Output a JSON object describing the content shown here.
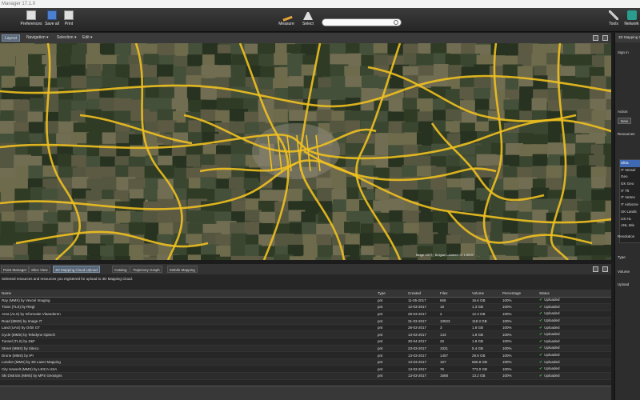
{
  "window": {
    "title": "Manager 17.1.0"
  },
  "ribbon": {
    "buttons": [
      {
        "label": "Preferences",
        "icon": "preferences-icon"
      },
      {
        "label": "Save all",
        "icon": "save-icon"
      },
      {
        "label": "Print",
        "icon": "print-icon"
      },
      {
        "label": "Measure",
        "icon": "measure-icon"
      },
      {
        "label": "Select",
        "icon": "select-icon"
      },
      {
        "label": "Tools",
        "icon": "tools-icon"
      },
      {
        "label": "Network",
        "icon": "network-icon"
      }
    ],
    "search_placeholder": ""
  },
  "map": {
    "tabs": [
      {
        "label": "Layout"
      },
      {
        "label": "Navigation ▾"
      },
      {
        "label": "Selection ▾"
      },
      {
        "label": "Edit ▾"
      }
    ],
    "status": "Belge 1977 · Belgian Lambert 72    1:5000",
    "colors": {
      "road": "#f0c020",
      "field_dark": "#2f3b25",
      "field_light": "#6e6a4c"
    }
  },
  "right_panel": {
    "title": "3D Mapping Cloud",
    "sign_in": "Sign in",
    "action": "Action",
    "new_button": "New",
    "resources": "Resources",
    "list": [
      "Ultra",
      "IT Vessel",
      "Geo",
      "GK Geo",
      "IT Tlt",
      "IT Vertex",
      "IT Airborne",
      "UK Lands",
      "US HL",
      "ANL Mis"
    ],
    "resolution_label": "Resolution",
    "type": "Type",
    "volume": "Volume",
    "upload": "Upload"
  },
  "bottom": {
    "tabs": [
      {
        "label": "Point Manager"
      },
      {
        "label": "Slice View"
      },
      {
        "label": "3D Mapping Cloud Upload"
      },
      {
        "label": "Catalog"
      },
      {
        "label": "Trajectory Graph"
      },
      {
        "label": "Mobile Mapping"
      }
    ],
    "info": "Selected resources and resources you registered for upload to 3D Mapping Cloud.",
    "columns": [
      "Name",
      "Type",
      "Created",
      "Files",
      "Volume",
      "Percentage",
      "Status"
    ],
    "rows": [
      [
        "Ray (MMS) by Vexcel Imaging",
        "pnt",
        "11-05-2017",
        "658",
        "16.6 GB",
        "100%",
        "Uploaded"
      ],
      [
        "Trans (TLS) by Riegl",
        "pnt",
        "12-03-2017",
        "18",
        "1.3 GB",
        "100%",
        "Uploaded"
      ],
      [
        "Area (ALS) by Informatie Vlaanderen",
        "pnt",
        "29-03-2017",
        "2",
        "12.3 GB",
        "100%",
        "Uploaded"
      ],
      [
        "Road (MMS) by Image IT",
        "pnt",
        "31-03-2017",
        "10523",
        "118.3 GB",
        "100%",
        "Uploaded"
      ],
      [
        "Land (UAS) by Orbit GT",
        "pnt",
        "28-03-2017",
        "3",
        "1.8 GB",
        "100%",
        "Uploaded"
      ],
      [
        "Cycle (MMS) by Teledyne Optech",
        "pnt",
        "13-03-2017",
        "143",
        "1.8 GB",
        "100%",
        "Uploaded"
      ],
      [
        "Tunnel (TLS) by Z&F",
        "pnt",
        "30-04-2017",
        "26",
        "1.8 GB",
        "100%",
        "Uploaded"
      ],
      [
        "Street (MMS) by Siteco",
        "pnt",
        "23-03-2017",
        "1021",
        "5.4 GB",
        "100%",
        "Uploaded"
      ],
      [
        "Drone (MMS) by IPI",
        "pnt",
        "13-03-2017",
        "1457",
        "29.8 GB",
        "100%",
        "Uploaded"
      ],
      [
        "London (MMS) by 3D Laser Mapping",
        "pnt",
        "13-03-2017",
        "157",
        "665.8 GB",
        "100%",
        "Uploaded"
      ],
      [
        "City Hasselt (MMS) by LEICA USA",
        "pnt",
        "13-03-2017",
        "76",
        "773.0 GB",
        "100%",
        "Uploaded"
      ],
      [
        "Ski Districts (MMS) by MPS Geosigns",
        "pnt",
        "13-03-2017",
        "1568",
        "13.2 GB",
        "100%",
        "Uploaded"
      ]
    ]
  }
}
